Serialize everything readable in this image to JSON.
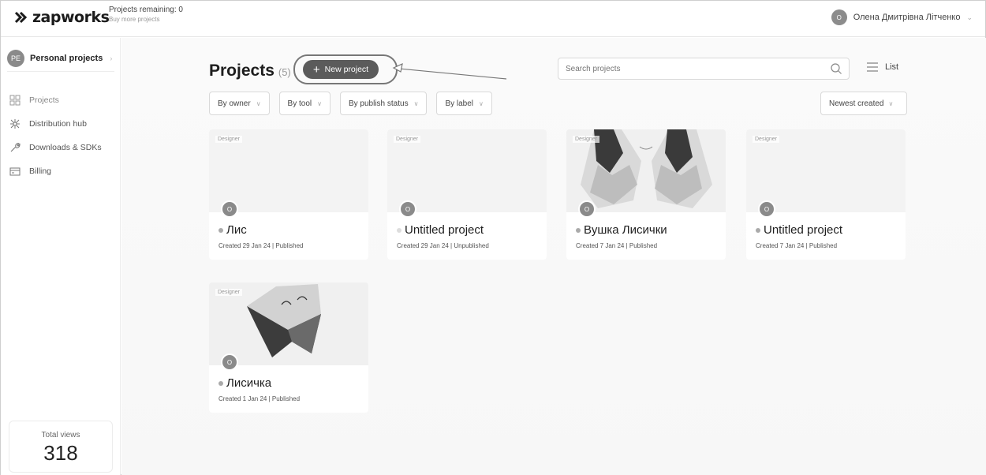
{
  "topbar": {
    "logo_text": "zapworks",
    "projects_remaining": "Projects remaining: 0",
    "buy_more": "Buy more projects",
    "user_initial": "O",
    "user_name": "Олена Дмитрівна Літченко"
  },
  "sidebar": {
    "workspace_initials": "PE",
    "workspace_label": "Personal projects",
    "items": [
      {
        "label": "Projects",
        "icon": "grid-icon"
      },
      {
        "label": "Distribution hub",
        "icon": "distribution-icon"
      },
      {
        "label": "Downloads & SDKs",
        "icon": "wrench-icon"
      },
      {
        "label": "Billing",
        "icon": "billing-icon"
      }
    ],
    "total_views_label": "Total views",
    "total_views": "318"
  },
  "main": {
    "title": "Projects",
    "count": "(5)",
    "new_project_label": "New project",
    "search_placeholder": "Search projects",
    "list_label": "List",
    "filters": [
      "By owner",
      "By tool",
      "By publish status",
      "By label"
    ],
    "sort_label": "Newest created",
    "projects": [
      {
        "tag": "Designer",
        "avatar": "O",
        "name": "Лис",
        "meta": "Created 29 Jan 24 | Published",
        "status": "published"
      },
      {
        "tag": "Designer",
        "avatar": "O",
        "name": "Untitled project",
        "meta": "Created 29 Jan 24 | Unpublished",
        "status": "unpublished"
      },
      {
        "tag": "Designer",
        "avatar": "O",
        "name": "Вушка Лисички",
        "meta": "Created 7 Jan 24 | Published",
        "status": "published"
      },
      {
        "tag": "Designer",
        "avatar": "O",
        "name": "Untitled project",
        "meta": "Created 7 Jan 24 | Published",
        "status": "published"
      },
      {
        "tag": "Designer",
        "avatar": "O",
        "name": "Лисичка",
        "meta": "Created 1 Jan 24 | Published",
        "status": "published"
      }
    ]
  },
  "colors": {
    "button_bg": "#5b5b5b",
    "avatar_bg": "#8a8a8a",
    "border": "#d9d9d9"
  }
}
